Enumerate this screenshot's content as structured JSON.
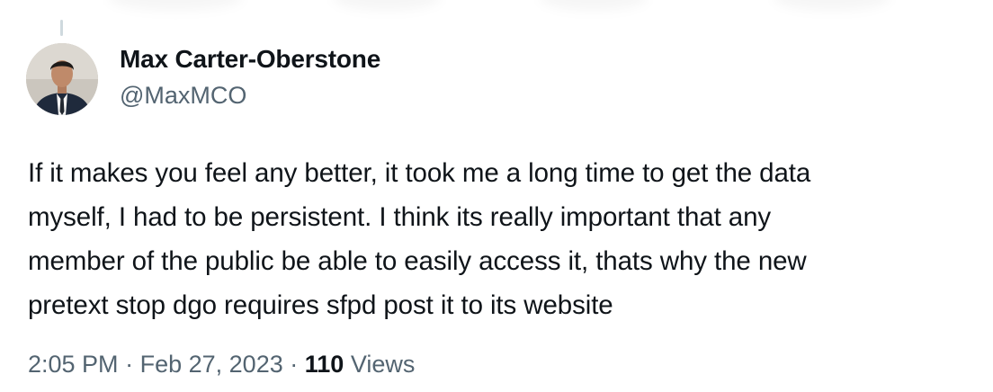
{
  "tweet": {
    "author": {
      "display_name": "Max Carter-Oberstone",
      "handle": "@MaxMCO"
    },
    "text_lines": [
      "If it makes you feel any better, it took me a long time to get the data",
      "myself, I had to be persistent. I think its really important that any",
      "member of the public be able to easily access it, thats why the new",
      "pretext stop dgo requires sfpd post it to its website"
    ],
    "time": "2:05 PM",
    "separator": "·",
    "date": "Feb 27, 2023",
    "views_count": "110",
    "views_label": "Views"
  },
  "colors": {
    "text": "#0f1419",
    "secondary": "#536471",
    "thread_line": "#cfd9de"
  }
}
